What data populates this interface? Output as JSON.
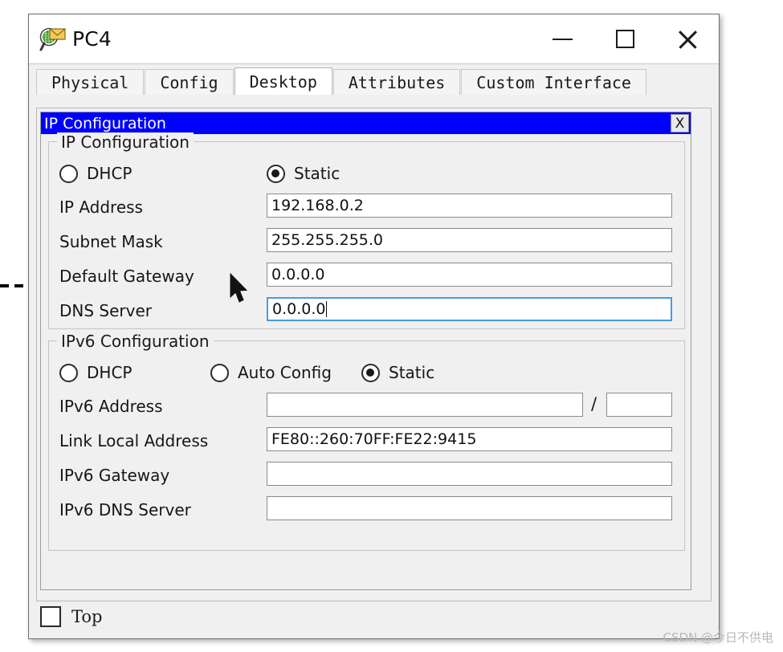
{
  "window": {
    "title": "PC4",
    "icon": "inspect-magnifier-envelope-icon",
    "controls": {
      "minimize": "minimize-icon",
      "maximize": "maximize-icon",
      "close": "close-icon"
    }
  },
  "tabs": [
    {
      "label": "Physical",
      "active": false
    },
    {
      "label": "Config",
      "active": false
    },
    {
      "label": "Desktop",
      "active": true
    },
    {
      "label": "Attributes",
      "active": false
    },
    {
      "label": "Custom Interface",
      "active": false
    }
  ],
  "ipcfg": {
    "window_title": "IP Configuration",
    "close_label": "X",
    "titlebar_color": "#0000ff",
    "ipv4": {
      "legend": "IP Configuration",
      "mode_options": [
        "DHCP",
        "Static"
      ],
      "selected_mode": "Static",
      "fields": [
        {
          "label": "IP Address",
          "value": "192.168.0.2",
          "focused": false
        },
        {
          "label": "Subnet Mask",
          "value": "255.255.255.0",
          "focused": false
        },
        {
          "label": "Default Gateway",
          "value": "0.0.0.0",
          "focused": false
        },
        {
          "label": "DNS Server",
          "value": "0.0.0.0",
          "focused": true
        }
      ]
    },
    "ipv6": {
      "legend": "IPv6 Configuration",
      "mode_options": [
        "DHCP",
        "Auto Config",
        "Static"
      ],
      "selected_mode": "Static",
      "address_label": "IPv6 Address",
      "address_value": "",
      "prefix_separator": "/",
      "prefix_value": "",
      "fields": [
        {
          "label": "Link Local Address",
          "value": "FE80::260:70FF:FE22:9415"
        },
        {
          "label": "IPv6 Gateway",
          "value": ""
        },
        {
          "label": "IPv6 DNS Server",
          "value": ""
        }
      ]
    }
  },
  "footer": {
    "top_checkbox_label": "Top",
    "top_checked": false
  },
  "watermark": "CSDN @今日不供电"
}
